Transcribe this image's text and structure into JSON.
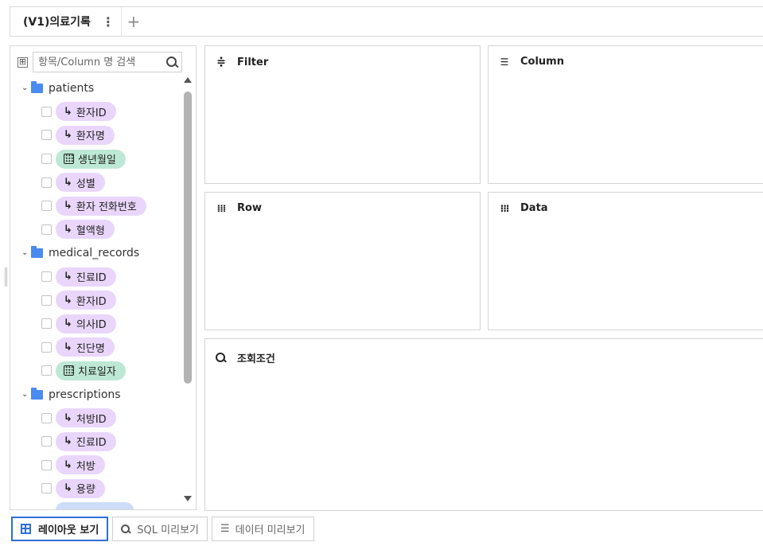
{
  "tabs": [
    {
      "label": "(V1)의료기록",
      "menu": "⋮"
    }
  ],
  "add_tab": "+",
  "search": {
    "placeholder": "항목/Column 명 검색",
    "expand_all": "⊞"
  },
  "tree": [
    {
      "label": "patients",
      "fields": [
        {
          "label": "환자ID",
          "kind": "dimension"
        },
        {
          "label": "환자명",
          "kind": "dimension"
        },
        {
          "label": "생년월일",
          "kind": "date"
        },
        {
          "label": "성별",
          "kind": "dimension"
        },
        {
          "label": "환자 전화번호",
          "kind": "dimension"
        },
        {
          "label": "혈액형",
          "kind": "dimension"
        }
      ]
    },
    {
      "label": "medical_records",
      "fields": [
        {
          "label": "진료ID",
          "kind": "dimension"
        },
        {
          "label": "환자ID",
          "kind": "dimension"
        },
        {
          "label": "의사ID",
          "kind": "dimension"
        },
        {
          "label": "진단명",
          "kind": "dimension"
        },
        {
          "label": "치료일자",
          "kind": "date"
        }
      ]
    },
    {
      "label": "prescriptions",
      "fields": [
        {
          "label": "처방ID",
          "kind": "dimension"
        },
        {
          "label": "진료ID",
          "kind": "dimension"
        },
        {
          "label": "처방",
          "kind": "dimension"
        },
        {
          "label": "용량",
          "kind": "dimension"
        }
      ]
    }
  ],
  "zones": {
    "filter": {
      "label": "Filter",
      "icon": "filter-icon"
    },
    "column": {
      "label": "Column",
      "icon": "column-icon"
    },
    "row": {
      "label": "Row",
      "icon": "row-icon"
    },
    "data": {
      "label": "Data",
      "icon": "data-icon"
    },
    "condition": {
      "label": "조회조건",
      "icon": "search-icon"
    }
  },
  "bottom": {
    "layout_view": "레이아웃 보기",
    "sql_preview": "SQL 미리보기",
    "data_preview": "데이터 미리보기"
  },
  "colors": {
    "dimension_pill": "#e9d6fa",
    "date_pill": "#bde8d5",
    "folder": "#4a8bf0",
    "active_button_border": "#2f6fd6"
  }
}
